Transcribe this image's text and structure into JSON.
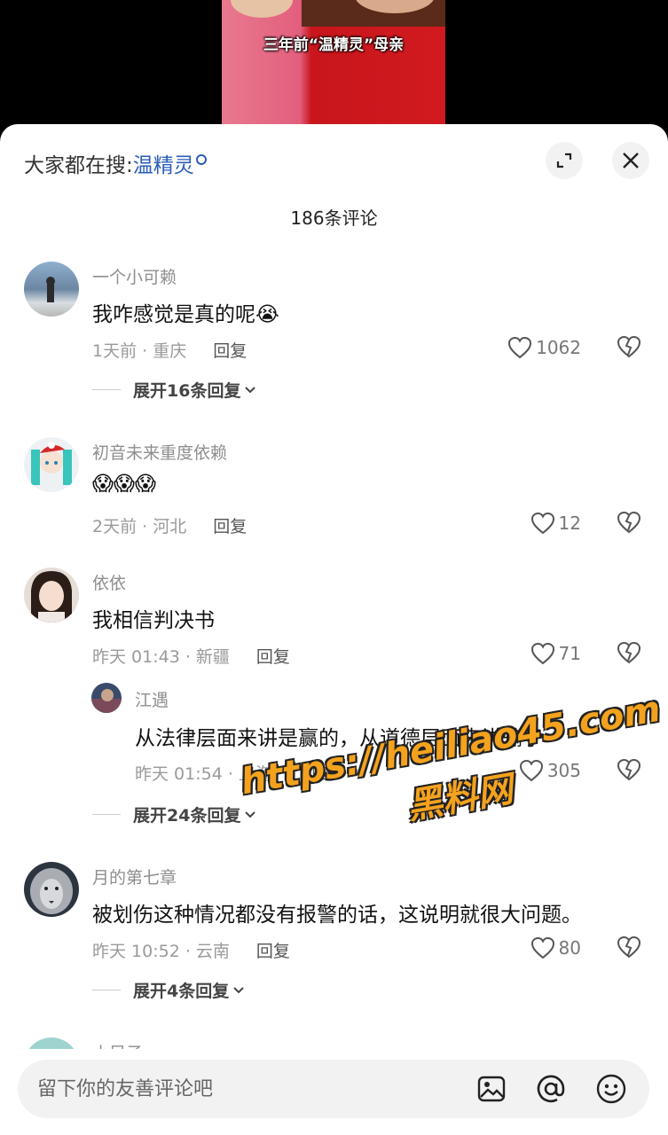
{
  "video": {
    "caption": "三年前“温精灵”母亲"
  },
  "search": {
    "prefix": "大家都在搜:",
    "keyword": "温精灵"
  },
  "header": {
    "count_label": "186条评论"
  },
  "comments": [
    {
      "user": "一个小可赖",
      "text": "我咋感觉是真的呢😭",
      "meta": "1天前 · 重庆",
      "reply": "回复",
      "likes": "1062",
      "expand": "展开16条回复"
    },
    {
      "user": "初音未来重度依赖",
      "text": "😱😱😱",
      "meta": "2天前 · 河北",
      "reply": "回复",
      "likes": "12"
    },
    {
      "user": "依依",
      "text": "我相信判决书",
      "meta": "昨天 01:43 · 新疆",
      "reply": "回复",
      "likes": "71",
      "sub": {
        "user": "江遇",
        "text": "从法律层面来讲是赢的，从道德层面来讲输了",
        "meta": "昨天 01:54 · 上海",
        "reply": "回复",
        "likes": "305"
      },
      "expand": "展开24条回复"
    },
    {
      "user": "月的第七章",
      "text": "被划伤这种情况都没有报警的话，这说明就很大问题。",
      "meta": "昨天 10:52 · 云南",
      "reply": "回复",
      "likes": "80",
      "expand": "展开4条回复"
    },
    {
      "user": "小目子"
    }
  ],
  "watermark": {
    "url": "https://heiliao45.com",
    "name": "黑料网"
  },
  "input": {
    "placeholder": "留下你的友善评论吧"
  },
  "icons": {
    "expand": "expand-icon",
    "close": "close-icon",
    "heart": "heart-icon",
    "dislike": "broken-heart-icon",
    "image": "image-icon",
    "at": "at-icon",
    "emoji": "emoji-icon"
  },
  "colors": {
    "keyword": "#2a5db8",
    "watermark": "#f4a21d"
  }
}
